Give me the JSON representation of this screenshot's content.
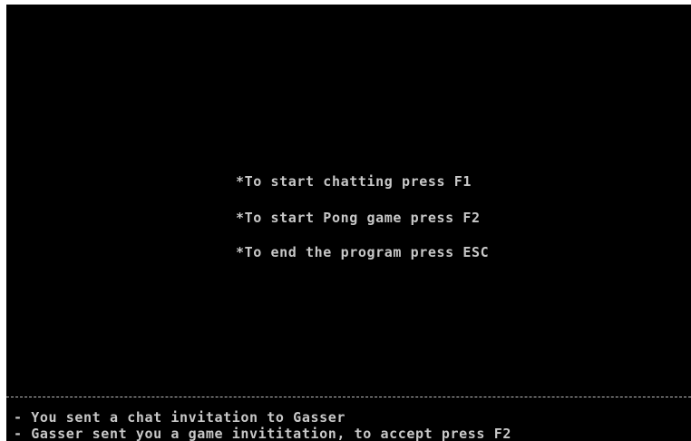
{
  "menu": {
    "options": [
      "*To start chatting press F1",
      "*To start Pong game press F2",
      "*To end the program press ESC"
    ]
  },
  "status": {
    "messages": [
      "- You sent a chat invitation to Gasser",
      "- Gasser sent you a game invititation, to accept press F2"
    ]
  },
  "colors": {
    "background": "#000000",
    "text": "#c8c8c8",
    "divider": "#bdbdbd"
  }
}
